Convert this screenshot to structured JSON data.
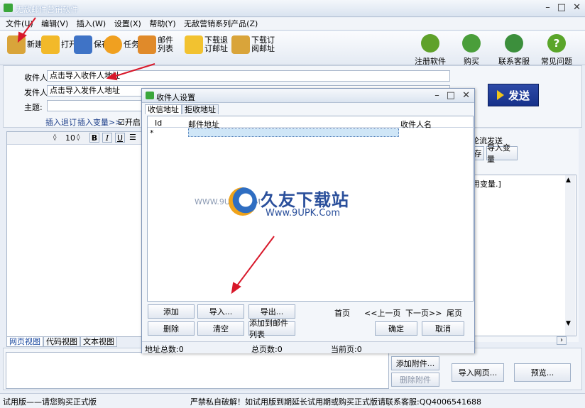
{
  "window": {
    "title": "无敌邮件营销软件",
    "controls": [
      "–",
      "□",
      "✕"
    ]
  },
  "menu": [
    "文件(U)",
    "编辑(V)",
    "插入(W)",
    "设置(X)",
    "帮助(Y)",
    "无敌营销系列产品(Z)"
  ],
  "toolbar": {
    "left": [
      {
        "label": "新建",
        "icon": "new-icon",
        "color": "#d9a43a"
      },
      {
        "label": "打开",
        "icon": "folder-icon",
        "color": "#f2b92a"
      },
      {
        "label": "保存",
        "icon": "save-icon",
        "color": "#3f73c6"
      },
      {
        "label": "任务",
        "icon": "task-icon",
        "color": "#f0a020"
      },
      {
        "label": "邮件列表",
        "icon": "mail-list-icon",
        "color": "#e08a2a"
      },
      {
        "label": "下载退订邮址",
        "icon": "download-icon",
        "color": "#f2c230"
      },
      {
        "label": "下载订阅邮址",
        "icon": "subscribe-icon",
        "color": "#d9a43a"
      }
    ],
    "right": [
      {
        "label": "注册软件",
        "icon": "register-icon",
        "color": "#5fa12a"
      },
      {
        "label": "购买",
        "icon": "cart-icon",
        "color": "#4a9e3a"
      },
      {
        "label": "联系客服",
        "icon": "support-icon",
        "color": "#3c8f3c"
      },
      {
        "label": "常见问题",
        "icon": "help-icon",
        "color": "#5aa52a"
      }
    ]
  },
  "form": {
    "recipient_label": "收件人:",
    "recipient_value": "点击导入收件人地址",
    "sender_label": "发件人:",
    "sender_value": "点击导入发件人地址",
    "subject_label": "主题:",
    "insert_unsub": "插入退订",
    "insert_var": "插入变量>>",
    "enable_label": "开启",
    "send_label": "发送"
  },
  "editor": {
    "font_size": "10",
    "bold": "B",
    "italic": "I",
    "underline": "U",
    "tabs": [
      "网页视图",
      "代码视图",
      "文本视图"
    ]
  },
  "right_panel": {
    "rotate_label": "轮流发送",
    "save_btn": "存",
    "import_var_btn": "导入变量",
    "box_text": "用变量.]"
  },
  "bottom": {
    "add_attach": "添加附件...",
    "del_attach": "删除附件",
    "import_web": "导入网页...",
    "preview": "预览..."
  },
  "status": {
    "left": "试用版——请您购买正式版",
    "right": "严禁私自破解！如试用版到期延长试用期或购买正式版请联系客服:QQ4006541688"
  },
  "dialog": {
    "title": "收件人设置",
    "tabs": [
      "收信地址",
      "拒收地址"
    ],
    "columns": [
      "Id",
      "邮件地址",
      "收件人名"
    ],
    "row_marker": "*",
    "buttons": {
      "add": "添加",
      "import": "导入...",
      "export": "导出...",
      "delete": "删除",
      "clear": "清空",
      "add_to_list": "添加到邮件列表",
      "ok": "确定",
      "cancel": "取消"
    },
    "paging": {
      "first": "首页",
      "prev": "<<上一页",
      "next": "下一页>>",
      "last": "尾页"
    },
    "status": {
      "total": "地址总数:0",
      "pages": "总页数:0",
      "current": "当前页:0"
    }
  },
  "watermark": {
    "prefix": "WWW.9UPK.COM",
    "cn": "久友下载站",
    "en": "Www.9UPK.Com"
  }
}
